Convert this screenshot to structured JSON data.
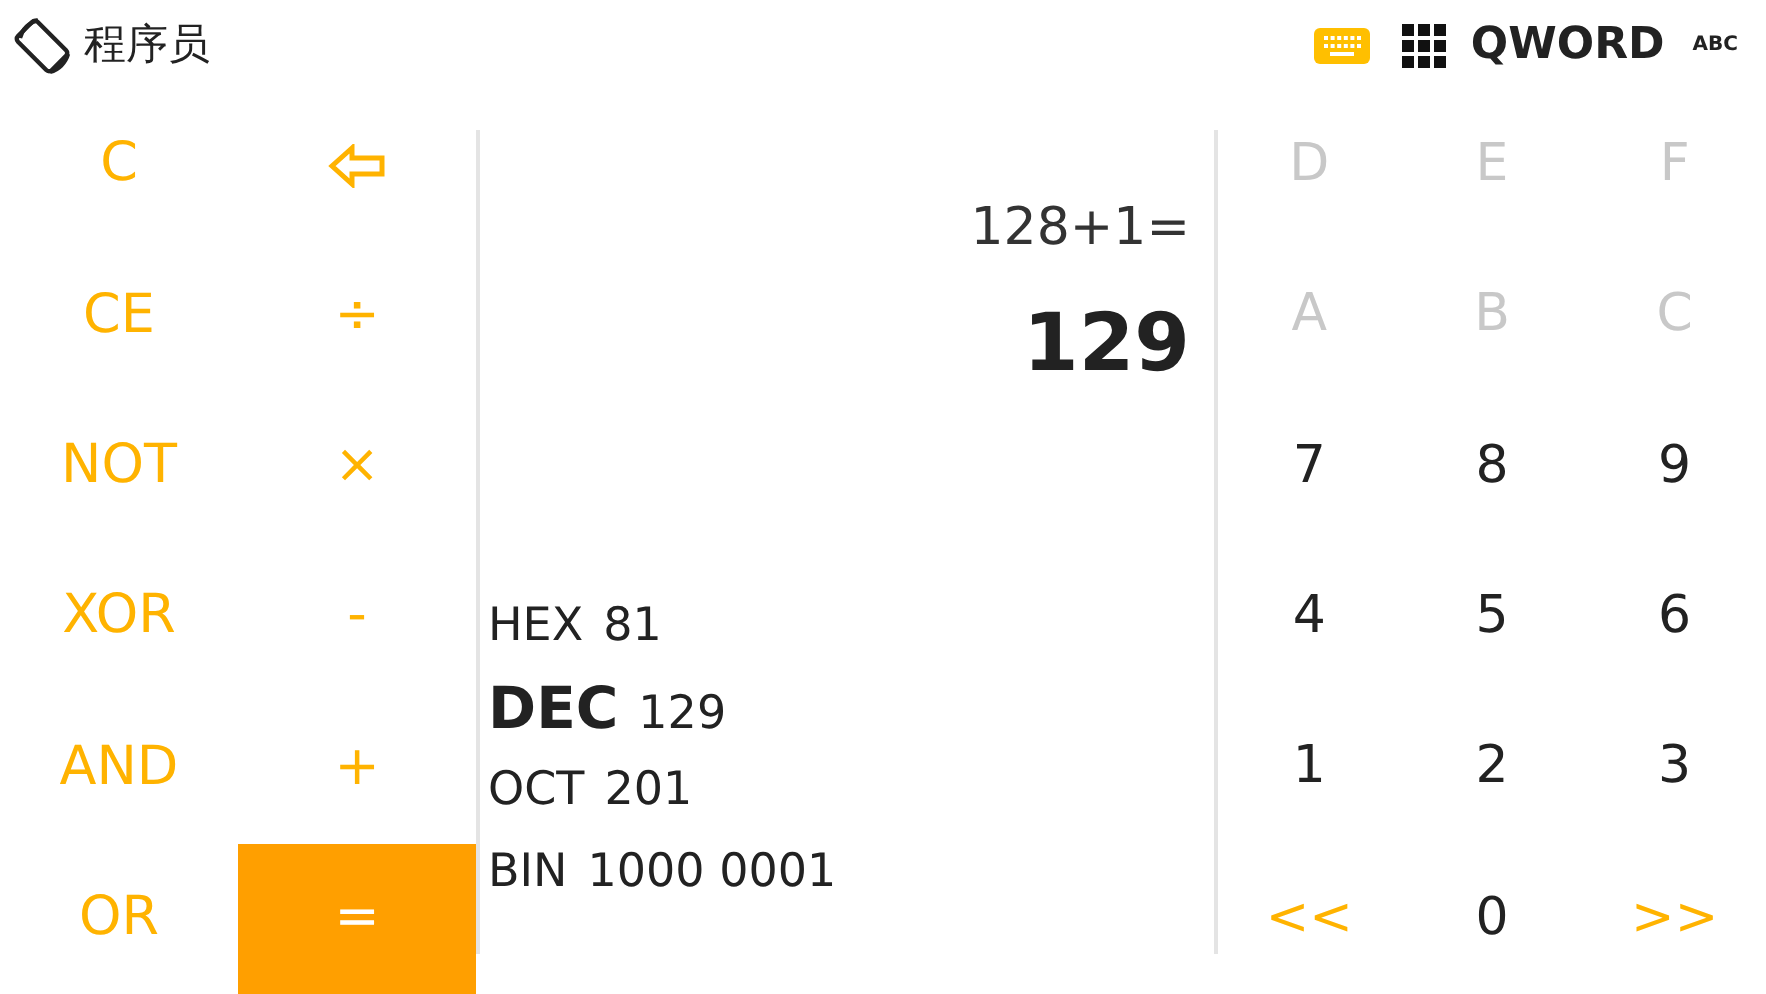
{
  "header": {
    "title": "程序员",
    "word_size": "QWORD",
    "mode_label": "ABC",
    "keyboard_active": true
  },
  "left_keys": [
    {
      "kind": "text",
      "label": "C"
    },
    {
      "kind": "backspace"
    },
    {
      "kind": "text",
      "label": "CE"
    },
    {
      "kind": "text",
      "label": "÷"
    },
    {
      "kind": "text",
      "label": "NOT"
    },
    {
      "kind": "text",
      "label": "×"
    },
    {
      "kind": "text",
      "label": "XOR"
    },
    {
      "kind": "text",
      "label": "-"
    },
    {
      "kind": "text",
      "label": "AND"
    },
    {
      "kind": "text",
      "label": "+"
    },
    {
      "kind": "text",
      "label": "OR"
    },
    {
      "kind": "primary",
      "label": "="
    }
  ],
  "display": {
    "expression": "128+1=",
    "result": "129"
  },
  "radix": [
    {
      "name": "HEX",
      "value": "81",
      "selected": false
    },
    {
      "name": "DEC",
      "value": "129",
      "selected": true
    },
    {
      "name": "OCT",
      "value": "201",
      "selected": false
    },
    {
      "name": "BIN",
      "value": "1000 0001",
      "selected": false
    }
  ],
  "right_keys": [
    {
      "kind": "digit",
      "label": "D",
      "disabled": true
    },
    {
      "kind": "digit",
      "label": "E",
      "disabled": true
    },
    {
      "kind": "digit",
      "label": "F",
      "disabled": true
    },
    {
      "kind": "digit",
      "label": "A",
      "disabled": true
    },
    {
      "kind": "digit",
      "label": "B",
      "disabled": true
    },
    {
      "kind": "digit",
      "label": "C",
      "disabled": true
    },
    {
      "kind": "digit",
      "label": "7",
      "disabled": false
    },
    {
      "kind": "digit",
      "label": "8",
      "disabled": false
    },
    {
      "kind": "digit",
      "label": "9",
      "disabled": false
    },
    {
      "kind": "digit",
      "label": "4",
      "disabled": false
    },
    {
      "kind": "digit",
      "label": "5",
      "disabled": false
    },
    {
      "kind": "digit",
      "label": "6",
      "disabled": false
    },
    {
      "kind": "digit",
      "label": "1",
      "disabled": false
    },
    {
      "kind": "digit",
      "label": "2",
      "disabled": false
    },
    {
      "kind": "digit",
      "label": "3",
      "disabled": false
    },
    {
      "kind": "shift",
      "label": "<<",
      "disabled": false
    },
    {
      "kind": "digit",
      "label": "0",
      "disabled": false
    },
    {
      "kind": "shift",
      "label": ">>",
      "disabled": false
    }
  ]
}
